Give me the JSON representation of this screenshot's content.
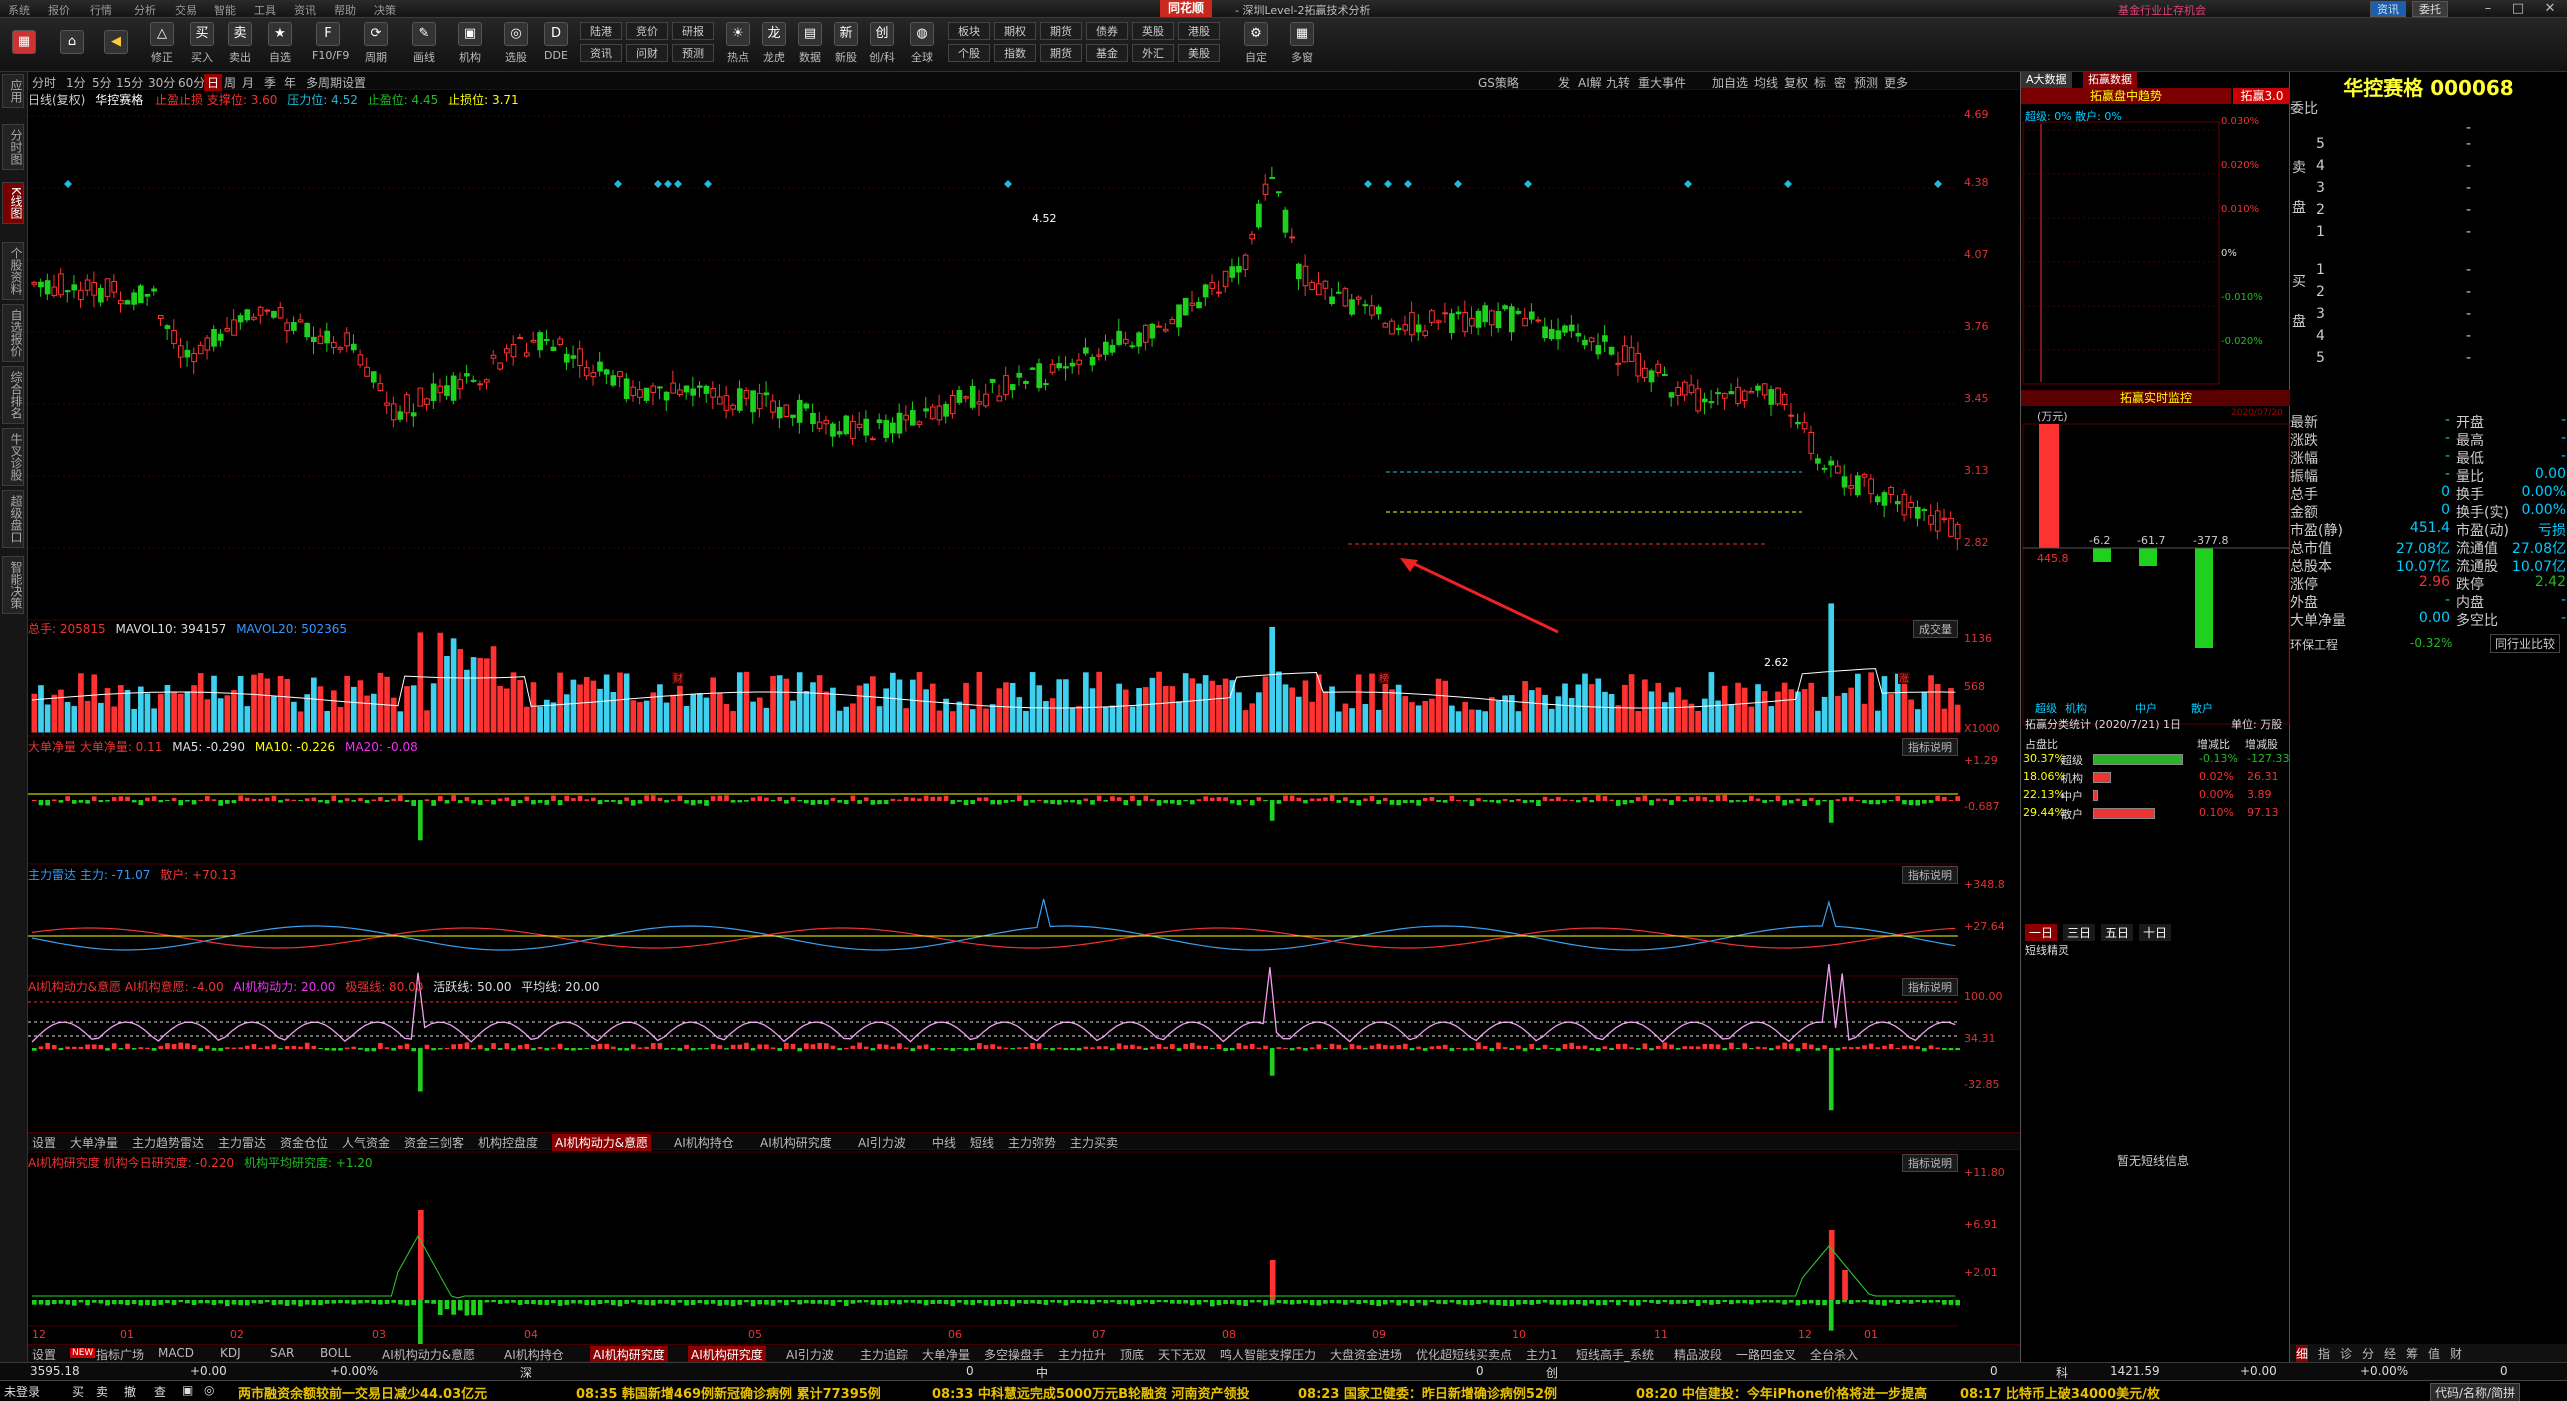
{
  "titlebar": {
    "menus": [
      "系统",
      "报价",
      "行情",
      "分析",
      "交易",
      "智能",
      "工具",
      "资讯",
      "帮助",
      "决策"
    ],
    "brand": "同花顺",
    "window_title": "- 深圳Level-2拓赢技术分析",
    "ad_text": "基金行业止存机会",
    "btn_info": "资讯",
    "btn_order": "委托"
  },
  "toolbar": {
    "items": [
      {
        "label": "修正",
        "icon": "△"
      },
      {
        "label": "买入",
        "icon": "买"
      },
      {
        "label": "卖出",
        "icon": "卖"
      },
      {
        "label": "自选",
        "icon": "★"
      },
      {
        "label": "F10/F9",
        "icon": "F"
      },
      {
        "label": "周期",
        "icon": "⟳"
      },
      {
        "label": "画线",
        "icon": "✎"
      },
      {
        "label": "机构",
        "icon": "▣"
      },
      {
        "label": "选股",
        "icon": "◎"
      },
      {
        "label": "DDE",
        "icon": "D"
      }
    ],
    "grid": [
      "陆港",
      "资讯",
      "竞价",
      "问财",
      "研报",
      "预测"
    ],
    "items2": [
      {
        "label": "热点",
        "icon": "☀"
      },
      {
        "label": "龙虎",
        "icon": "龙"
      },
      {
        "label": "数据",
        "icon": "▤"
      },
      {
        "label": "新股",
        "icon": "新"
      },
      {
        "label": "创/科",
        "icon": "创"
      },
      {
        "label": "全球",
        "icon": "◍"
      }
    ],
    "grid2": [
      "板块",
      "个股",
      "期权",
      "指数",
      "期货",
      "期货",
      "债券",
      "基金",
      "英股",
      "外汇",
      "港股",
      "美股"
    ],
    "items3": [
      {
        "label": "自定",
        "icon": "⚙"
      },
      {
        "label": "多窗",
        "icon": "▦"
      }
    ]
  },
  "lefttabs": [
    "应用",
    "分时图",
    "K线图",
    "个股资料",
    "自选报价",
    "综合排名",
    "牛叉诊股",
    "超级盘口",
    "智能决策"
  ],
  "period": {
    "items": [
      "分时",
      "1分",
      "5分",
      "15分",
      "30分",
      "60分",
      "日",
      "周",
      "月",
      "季",
      "年",
      "多周期",
      "设置"
    ],
    "active": "日",
    "right_items": [
      "GS策略",
      "发",
      "AI解",
      "九转",
      "重大事件",
      "加自选",
      "均线",
      "复权",
      "标",
      "密",
      "预测",
      "更多"
    ]
  },
  "kline": {
    "info_prefix": "日线(复权)",
    "name": "华控赛格",
    "support": "止盈止损 支撑位: 3.60",
    "pressure": "压力位: 4.52",
    "stop_profit": "止盈位: 4.45",
    "stop_loss": "止损位: 3.71",
    "axis": [
      "4.69",
      "4.38",
      "4.07",
      "3.76",
      "3.45",
      "3.13",
      "2.82"
    ],
    "annot_high": "4.52",
    "annot_low": "2.62",
    "events": [
      "财",
      "榜",
      "涨"
    ]
  },
  "volume": {
    "title": "总手: 205815",
    "ma10": "MAVOL10: 394157",
    "ma20": "MAVOL20: 502365",
    "axis": [
      "1136",
      "568"
    ],
    "unit": "X1000",
    "btn": "成交量"
  },
  "bignet": {
    "title": "大单净量  大单净量: 0.11",
    "ma5": "MA5: -0.290",
    "ma10": "MA10: -0.226",
    "ma20": "MA20: -0.08",
    "axis": [
      "+1.29",
      "-0.687"
    ],
    "btn": "指标说明"
  },
  "radar": {
    "title": "主力雷达  主力: -71.07",
    "sanhu": "散户: +70.13",
    "axis": [
      "+348.8",
      "+27.64"
    ],
    "btn": "指标说明"
  },
  "aidyn": {
    "title": "AI机构动力&意愿  AI机构意愿: -4.00",
    "power": "AI机构动力: 20.00",
    "limit": "极强线: 80.00",
    "active": "活跃线: 50.00",
    "avg": "平均线: 20.00",
    "axis": [
      "100.00",
      "34.31",
      "-32.85"
    ],
    "btn": "指标说明"
  },
  "tabs1": [
    "设置",
    "大单净量",
    "主力趋势雷达",
    "主力雷达",
    "资金仓位",
    "人气资金",
    "资金三剑客",
    "机构控盘度",
    "AI机构动力&意愿",
    "AI机构持仓",
    "AI机构研究度",
    "AI引力波",
    "中线",
    "短线",
    "主力弥势",
    "主力买卖"
  ],
  "tabs1_active": "AI机构动力&意愿",
  "research": {
    "title": "AI机构研究度  机构今日研究度: -0.220",
    "avg": "机构平均研究度: +1.20",
    "axis": [
      "+11.80",
      "+6.91",
      "+2.01"
    ],
    "btn": "指标说明"
  },
  "months": [
    "12",
    "01",
    "02",
    "03",
    "04",
    "05",
    "06",
    "07",
    "08",
    "09",
    "10",
    "11",
    "12",
    "01"
  ],
  "tabs2": [
    "设置",
    "指标广场",
    "MACD",
    "KDJ",
    "SAR",
    "BOLL",
    "AI机构动力&意愿",
    "AI机构持仓",
    "AI机构研究度",
    "AI机构研究度",
    "AI引力波",
    "主力追踪",
    "大单净量",
    "多空操盘手",
    "主力拉升",
    "顶底",
    "天下无双",
    "鸣人智能支撑压力",
    "大盘资金进场",
    "优化超短线买卖点",
    "主力1",
    "短线高手_系统",
    "精品波段",
    "一路四金叉",
    "全台杀入"
  ],
  "tabs2_active": "AI机构研究度",
  "tabs2_new": "NEW",
  "midpanel": {
    "tab1": "A大数据",
    "tab2": "拓赢数据",
    "sec1_title": "拓赢盘中趋势",
    "sec1_badge": "拓赢3.0",
    "legend": "超级: 0%  散户: 0%",
    "pct_axis": [
      "0.030%",
      "0.020%",
      "0.010%",
      "0%",
      "-0.010%",
      "-0.020%"
    ],
    "sec2_title": "拓赢实时监控",
    "unit": "(万元)",
    "date_small": "2020/07/20",
    "flow_values": [
      "-6.2",
      "-61.7",
      "-377.8"
    ],
    "flow_left": "445.8",
    "legend2": [
      "超级",
      "机构",
      "中户",
      "散户"
    ],
    "stat_title": "拓赢分类统计 (2020/7/21) 1日",
    "stat_unit": "单位: 万股",
    "stat_headers": [
      "占盘比",
      "增减比",
      "增减股"
    ],
    "stats": [
      {
        "pct": "30.37%",
        "name": "超级",
        "chg": "-0.13%",
        "shares": "-127.33",
        "bar": 0.9
      },
      {
        "pct": "18.06%",
        "name": "机构",
        "chg": "0.02%",
        "shares": "26.31",
        "bar": 0.18
      },
      {
        "pct": "22.13%",
        "name": "中户",
        "chg": "0.00%",
        "shares": "3.89",
        "bar": 0.05
      },
      {
        "pct": "29.44%",
        "name": "散户",
        "chg": "0.10%",
        "shares": "97.13",
        "bar": 0.62
      }
    ],
    "day_tabs": [
      "一日",
      "三日",
      "五日",
      "十日"
    ],
    "short_title": "短线精灵",
    "no_info": "暂无短线信息"
  },
  "right": {
    "title": "华控赛格 000068",
    "weibi": "委比",
    "weicha": "-",
    "sell_label": "卖盘",
    "buy_label": "买盘",
    "levels": [
      "5",
      "4",
      "3",
      "2",
      "1",
      "1",
      "2",
      "3",
      "4",
      "5"
    ],
    "dash": "-",
    "stats": [
      [
        "最新",
        "-",
        "开盘",
        "-"
      ],
      [
        "涨跌",
        "-",
        "最高",
        "-"
      ],
      [
        "涨幅",
        "-",
        "最低",
        "-"
      ],
      [
        "振幅",
        "-",
        "量比",
        "0.00"
      ],
      [
        "总手",
        "0",
        "换手",
        "0.00%"
      ],
      [
        "金额",
        "0",
        "换手(实)",
        "0.00%"
      ],
      [
        "市盈(静)",
        "451.4",
        "市盈(动)",
        "亏损"
      ],
      [
        "总市值",
        "27.08亿",
        "流通值",
        "27.08亿"
      ],
      [
        "总股本",
        "10.07亿",
        "流通股",
        "10.07亿"
      ],
      [
        "涨停",
        "2.96",
        "跌停",
        "2.42"
      ],
      [
        "外盘",
        "-",
        "内盘",
        "-"
      ],
      [
        "大单净量",
        "0.00",
        "多空比",
        "-"
      ]
    ],
    "industry": "环保工程",
    "industry_chg": "-0.32%",
    "industry_btn": "同行业比较",
    "bottom_tabs": [
      "细",
      "指",
      "诊",
      "分",
      "经",
      "筹",
      "值",
      "财"
    ]
  },
  "bottomstrip": {
    "index_label": "3595.18",
    "a1": "+0.00",
    "a2": "+0.00%",
    "sz": "深",
    "zhong": "中",
    "chuang": "创",
    "ke": "科",
    "kv": "1421.59",
    "kchg": "+0.00",
    "kpct": "+0.00%",
    "z0": "0",
    "z1": "0",
    "z2": "0",
    "z3": "0"
  },
  "ticker": {
    "buttons": [
      "未登录",
      "买",
      "卖",
      "撤",
      "查",
      "▣",
      "◎"
    ],
    "items": [
      "两市融资余额较前一交易日减少44.03亿元",
      "08:35 韩国新增469例新冠确诊病例 累计77395例",
      "08:33 中科慧远完成5000万元B轮融资 河南资产领投",
      "08:23 国家卫健委：昨日新增确诊病例52例",
      "08:20 中信建投：今年iPhone价格将进一步提高",
      "08:17 比特币上破34000美元/枚"
    ],
    "right_btn": "代码/名称/简拼"
  }
}
